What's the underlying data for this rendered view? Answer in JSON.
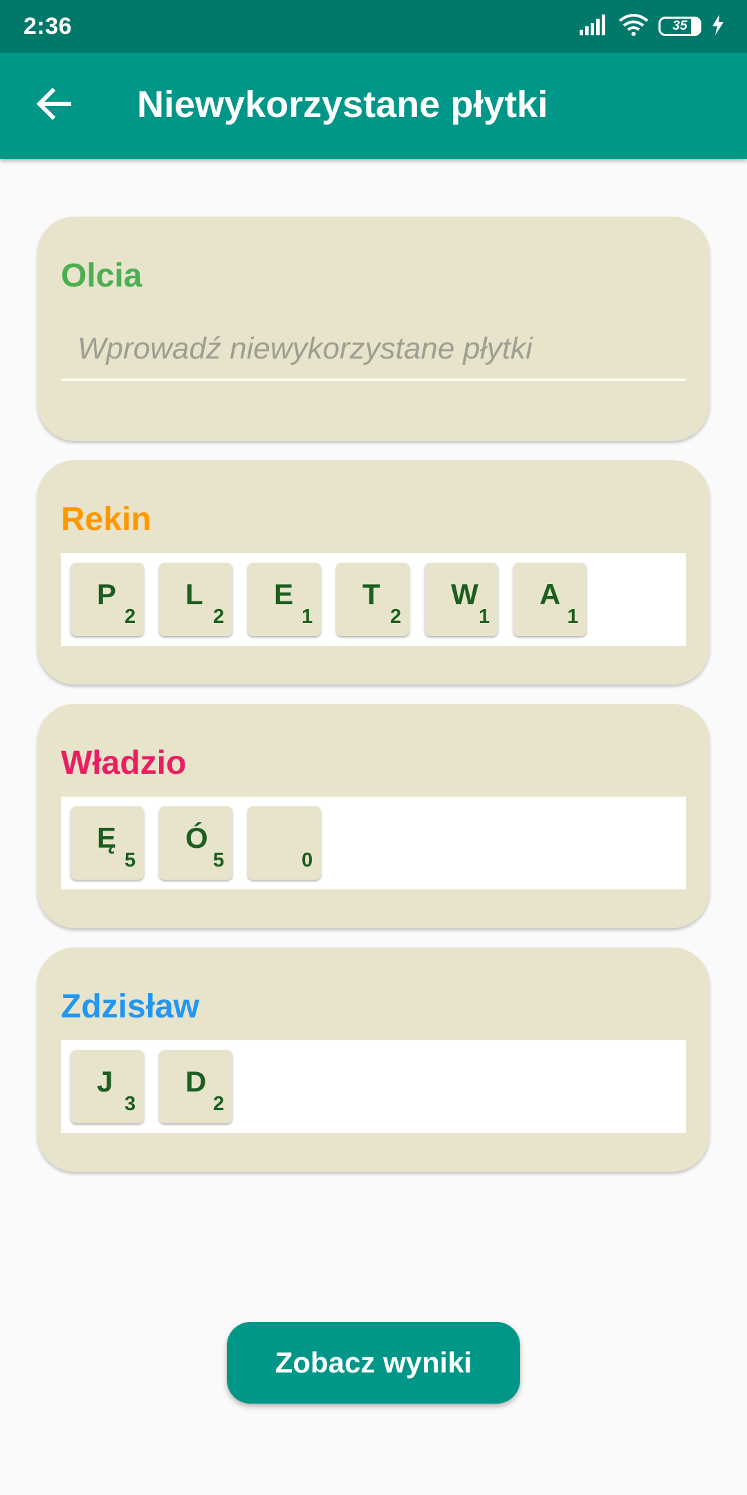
{
  "status_bar": {
    "time": "2:36",
    "battery_level": "35",
    "icons": [
      "signal-icon",
      "wifi-icon",
      "battery-icon",
      "charging-icon"
    ]
  },
  "app_bar": {
    "title": "Niewykorzystane płytki",
    "back_icon": "back-arrow-icon"
  },
  "players": [
    {
      "name": "Olcia",
      "color": "#4caf50",
      "input_placeholder": "Wprowadź niewykorzystane płytki",
      "input_value": "",
      "tiles": []
    },
    {
      "name": "Rekin",
      "color": "#ff9800",
      "tiles": [
        {
          "letter": "P",
          "value": "2"
        },
        {
          "letter": "L",
          "value": "2"
        },
        {
          "letter": "E",
          "value": "1"
        },
        {
          "letter": "T",
          "value": "2"
        },
        {
          "letter": "W",
          "value": "1"
        },
        {
          "letter": "A",
          "value": "1"
        }
      ]
    },
    {
      "name": "Władzio",
      "color": "#e91e63",
      "tiles": [
        {
          "letter": "Ę",
          "value": "5"
        },
        {
          "letter": "Ó",
          "value": "5"
        },
        {
          "letter": "",
          "value": "0"
        }
      ]
    },
    {
      "name": "Zdzisław",
      "color": "#2196f3",
      "tiles": [
        {
          "letter": "J",
          "value": "3"
        },
        {
          "letter": "D",
          "value": "2"
        }
      ]
    }
  ],
  "results_button": {
    "label": "Zobacz wyniki"
  },
  "colors": {
    "status_bar": "#00796b",
    "app_bar": "#009688",
    "card_background": "#e8e4cb",
    "tile_text": "#1b5e20",
    "button": "#009688"
  }
}
